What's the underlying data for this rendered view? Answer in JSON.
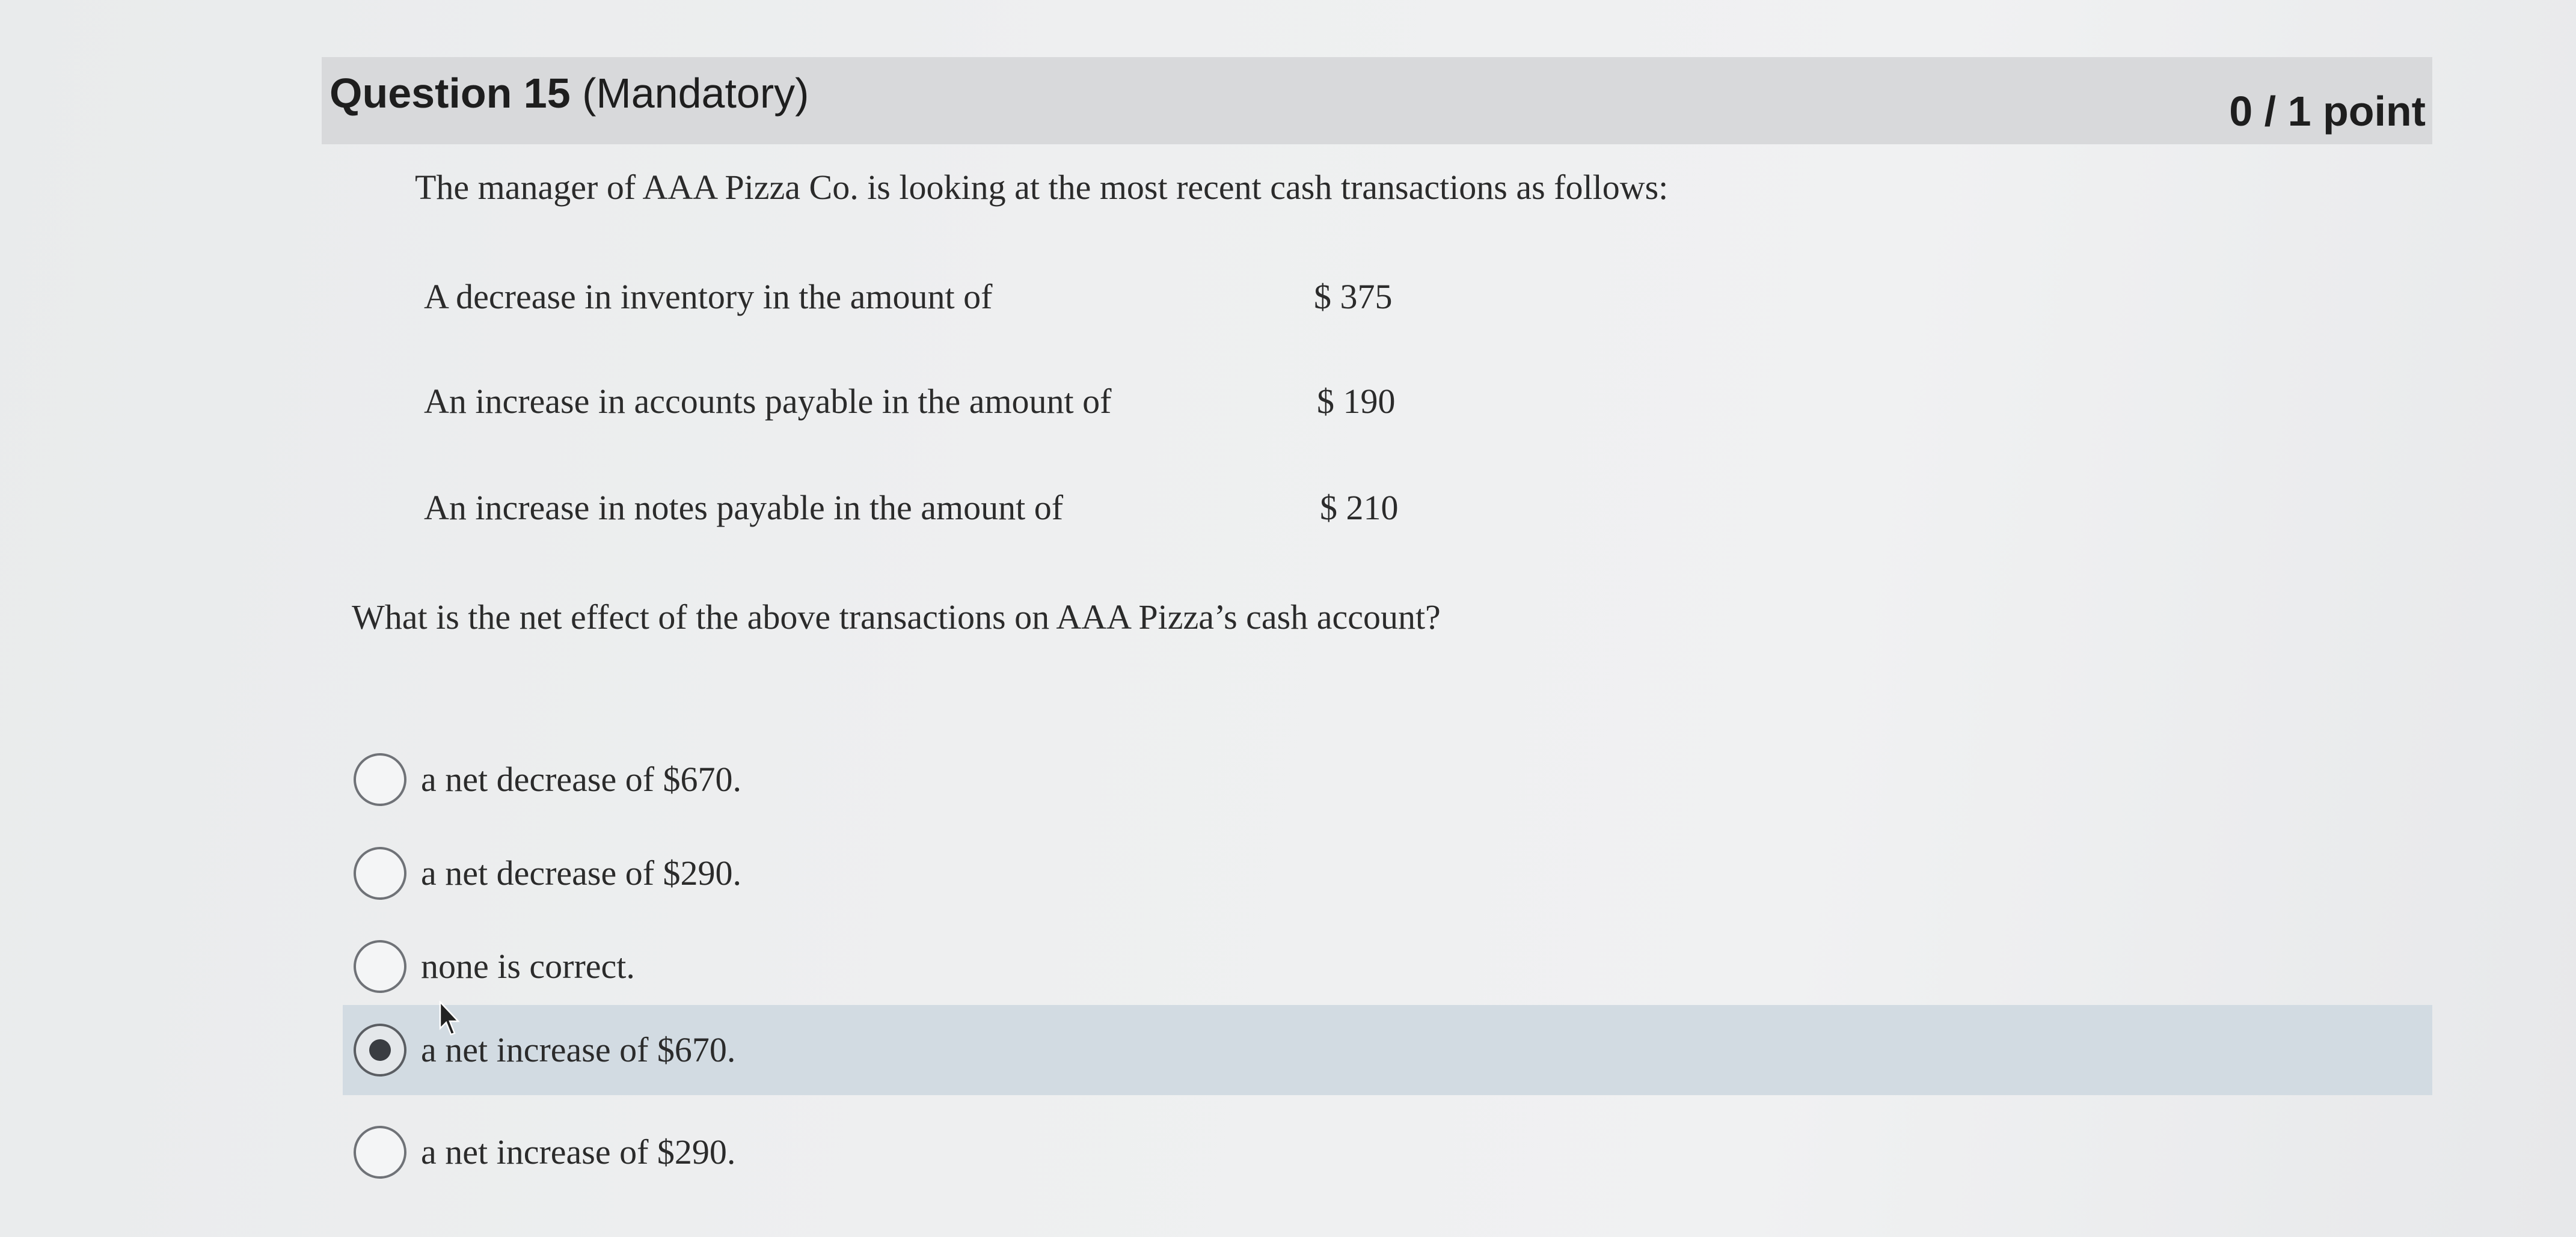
{
  "question": {
    "title_number": "Question 15",
    "title_status": "(Mandatory)",
    "points": "0 / 1 point",
    "stem": "The manager of AAA Pizza Co. is looking at the most recent cash transactions as follows:",
    "transactions": [
      {
        "label": "A decrease in inventory in the amount of",
        "amount": "$ 375"
      },
      {
        "label": "An increase in accounts payable in the amount of",
        "amount": "$ 190"
      },
      {
        "label": "An increase in notes payable in the amount of",
        "amount": "$ 210"
      }
    ],
    "prompt": "What is the net effect of the above transactions on AAA Pizza’s cash account?",
    "options": [
      {
        "label": "a net decrease of $670.",
        "selected": false
      },
      {
        "label": "a net decrease of $290.",
        "selected": false
      },
      {
        "label": "none is correct.",
        "selected": false
      },
      {
        "label": "a net increase of $670.",
        "selected": true
      },
      {
        "label": "a net increase of $290.",
        "selected": false
      }
    ]
  },
  "colors": {
    "header_bar": "#d8d9db",
    "selected_option_bg": "#d2dbe2",
    "text": "#2b2b2b"
  },
  "icons": {
    "cursor": "mouse-pointer-icon",
    "radio_unchecked": "radio-unchecked-icon",
    "radio_checked": "radio-checked-icon"
  }
}
